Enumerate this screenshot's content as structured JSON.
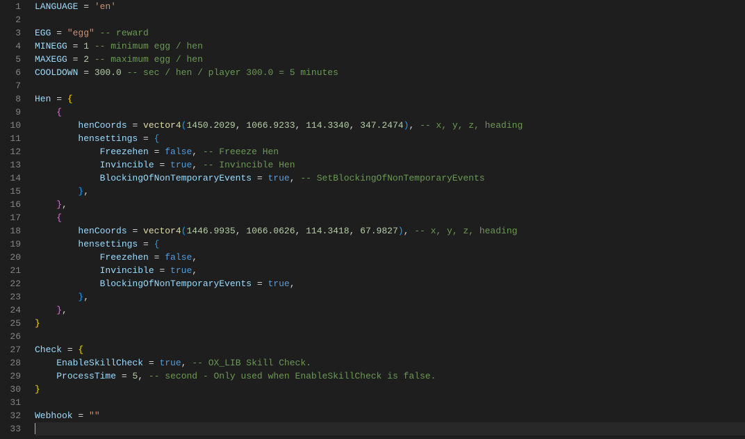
{
  "editor": {
    "lineCount": 33,
    "lines": {
      "1": [
        [
          "kw",
          "LANGUAGE"
        ],
        [
          "op",
          " = "
        ],
        [
          "str",
          "'en'"
        ]
      ],
      "3": [
        [
          "kw",
          "EGG"
        ],
        [
          "op",
          " = "
        ],
        [
          "str",
          "\"egg\""
        ],
        [
          "op",
          " "
        ],
        [
          "com",
          "-- reward"
        ]
      ],
      "4": [
        [
          "kw",
          "MINEGG"
        ],
        [
          "op",
          " = "
        ],
        [
          "num",
          "1"
        ],
        [
          "op",
          " "
        ],
        [
          "com",
          "-- minimum egg / hen"
        ]
      ],
      "5": [
        [
          "kw",
          "MAXEGG"
        ],
        [
          "op",
          " = "
        ],
        [
          "num",
          "2"
        ],
        [
          "op",
          " "
        ],
        [
          "com",
          "-- maximum egg / hen"
        ]
      ],
      "6": [
        [
          "kw",
          "COOLDOWN"
        ],
        [
          "op",
          " = "
        ],
        [
          "num",
          "300.0"
        ],
        [
          "op",
          " "
        ],
        [
          "com",
          "-- sec / hen / player 300.0 = 5 minutes"
        ]
      ],
      "8": [
        [
          "kw",
          "Hen"
        ],
        [
          "op",
          " = "
        ],
        [
          "brc",
          "{"
        ]
      ],
      "9": [
        [
          "op",
          "    "
        ],
        [
          "brcM",
          "{"
        ]
      ],
      "10": [
        [
          "op",
          "        "
        ],
        [
          "kw",
          "henCoords"
        ],
        [
          "op",
          " = "
        ],
        [
          "func",
          "vector4"
        ],
        [
          "brcB",
          "("
        ],
        [
          "num",
          "1450.2029"
        ],
        [
          "op",
          ", "
        ],
        [
          "num",
          "1066.9233"
        ],
        [
          "op",
          ", "
        ],
        [
          "num",
          "114.3340"
        ],
        [
          "op",
          ", "
        ],
        [
          "num",
          "347.2474"
        ],
        [
          "brcB",
          ")"
        ],
        [
          "op",
          ","
        ],
        [
          "op",
          " "
        ],
        [
          "com",
          "-- x, y, z, heading"
        ]
      ],
      "11": [
        [
          "op",
          "        "
        ],
        [
          "kw",
          "hensettings"
        ],
        [
          "op",
          " = "
        ],
        [
          "brcB",
          "{"
        ]
      ],
      "12": [
        [
          "op",
          "            "
        ],
        [
          "kw",
          "Freezehen"
        ],
        [
          "op",
          " = "
        ],
        [
          "bool",
          "false"
        ],
        [
          "op",
          ","
        ],
        [
          "op",
          " "
        ],
        [
          "com",
          "-- Freeeze Hen"
        ]
      ],
      "13": [
        [
          "op",
          "            "
        ],
        [
          "kw",
          "Invincible"
        ],
        [
          "op",
          " = "
        ],
        [
          "bool",
          "true"
        ],
        [
          "op",
          ","
        ],
        [
          "op",
          " "
        ],
        [
          "com",
          "-- Invincible Hen"
        ]
      ],
      "14": [
        [
          "op",
          "            "
        ],
        [
          "kw",
          "BlockingOfNonTemporaryEvents"
        ],
        [
          "op",
          " = "
        ],
        [
          "bool",
          "true"
        ],
        [
          "op",
          ","
        ],
        [
          "op",
          " "
        ],
        [
          "com",
          "-- SetBlockingOfNonTemporaryEvents"
        ]
      ],
      "15": [
        [
          "op",
          "        "
        ],
        [
          "brcB",
          "}"
        ],
        [
          "op",
          ","
        ]
      ],
      "16": [
        [
          "op",
          "    "
        ],
        [
          "brcM",
          "}"
        ],
        [
          "op",
          ","
        ]
      ],
      "17": [
        [
          "op",
          "    "
        ],
        [
          "brcM",
          "{"
        ]
      ],
      "18": [
        [
          "op",
          "        "
        ],
        [
          "kw",
          "henCoords"
        ],
        [
          "op",
          " = "
        ],
        [
          "func",
          "vector4"
        ],
        [
          "brcB",
          "("
        ],
        [
          "num",
          "1446.9935"
        ],
        [
          "op",
          ", "
        ],
        [
          "num",
          "1066.0626"
        ],
        [
          "op",
          ", "
        ],
        [
          "num",
          "114.3418"
        ],
        [
          "op",
          ", "
        ],
        [
          "num",
          "67.9827"
        ],
        [
          "brcB",
          ")"
        ],
        [
          "op",
          ","
        ],
        [
          "op",
          " "
        ],
        [
          "com",
          "-- x, y, z, heading"
        ]
      ],
      "19": [
        [
          "op",
          "        "
        ],
        [
          "kw",
          "hensettings"
        ],
        [
          "op",
          " = "
        ],
        [
          "brcB",
          "{"
        ]
      ],
      "20": [
        [
          "op",
          "            "
        ],
        [
          "kw",
          "Freezehen"
        ],
        [
          "op",
          " = "
        ],
        [
          "bool",
          "false"
        ],
        [
          "op",
          ","
        ]
      ],
      "21": [
        [
          "op",
          "            "
        ],
        [
          "kw",
          "Invincible"
        ],
        [
          "op",
          " = "
        ],
        [
          "bool",
          "true"
        ],
        [
          "op",
          ","
        ]
      ],
      "22": [
        [
          "op",
          "            "
        ],
        [
          "kw",
          "BlockingOfNonTemporaryEvents"
        ],
        [
          "op",
          " = "
        ],
        [
          "bool",
          "true"
        ],
        [
          "op",
          ","
        ]
      ],
      "23": [
        [
          "op",
          "        "
        ],
        [
          "brcB",
          "}"
        ],
        [
          "op",
          ","
        ]
      ],
      "24": [
        [
          "op",
          "    "
        ],
        [
          "brcM",
          "}"
        ],
        [
          "op",
          ","
        ]
      ],
      "25": [
        [
          "brc",
          "}"
        ]
      ],
      "27": [
        [
          "kw",
          "Check"
        ],
        [
          "op",
          " = "
        ],
        [
          "brc",
          "{"
        ]
      ],
      "28": [
        [
          "op",
          "    "
        ],
        [
          "kw",
          "EnableSkillCheck"
        ],
        [
          "op",
          " = "
        ],
        [
          "bool",
          "true"
        ],
        [
          "op",
          ","
        ],
        [
          "op",
          " "
        ],
        [
          "com",
          "-- OX_LIB Skill Check."
        ]
      ],
      "29": [
        [
          "op",
          "    "
        ],
        [
          "kw",
          "ProcessTime"
        ],
        [
          "op",
          " = "
        ],
        [
          "num",
          "5"
        ],
        [
          "op",
          ","
        ],
        [
          "op",
          " "
        ],
        [
          "com",
          "-- second - Only used when EnableSkillCheck is false."
        ]
      ],
      "30": [
        [
          "brc",
          "}"
        ]
      ],
      "32": [
        [
          "kw",
          "Webhook"
        ],
        [
          "op",
          " = "
        ],
        [
          "str",
          "\"\""
        ]
      ]
    }
  },
  "config_data": {
    "LANGUAGE": "en",
    "EGG": "egg",
    "MINEGG": 1,
    "MAXEGG": 2,
    "COOLDOWN": 300.0,
    "Hen": [
      {
        "henCoords": {
          "x": 1450.2029,
          "y": 1066.9233,
          "z": 114.334,
          "heading": 347.2474
        },
        "hensettings": {
          "Freezehen": false,
          "Invincible": true,
          "BlockingOfNonTemporaryEvents": true
        }
      },
      {
        "henCoords": {
          "x": 1446.9935,
          "y": 1066.0626,
          "z": 114.3418,
          "heading": 67.9827
        },
        "hensettings": {
          "Freezehen": false,
          "Invincible": true,
          "BlockingOfNonTemporaryEvents": true
        }
      }
    ],
    "Check": {
      "EnableSkillCheck": true,
      "ProcessTime": 5
    },
    "Webhook": ""
  }
}
